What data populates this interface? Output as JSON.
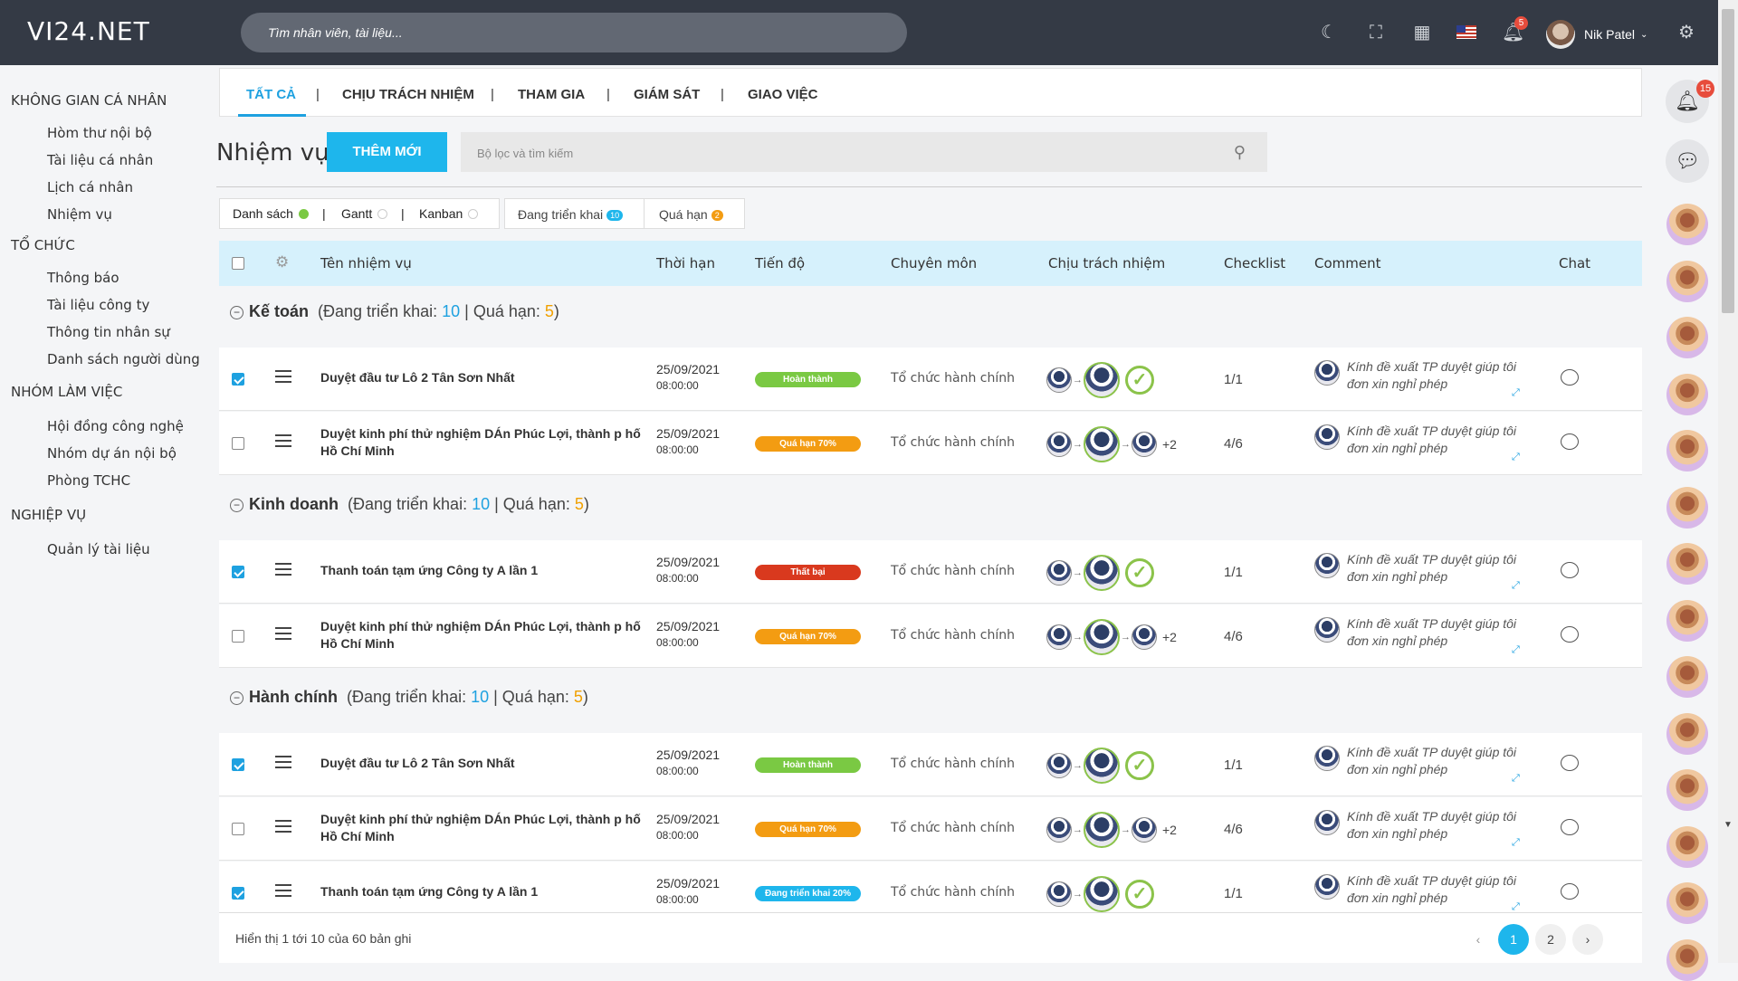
{
  "app": {
    "logo": "VI24.NET",
    "search_placeholder": "Tìm nhân viên, tài liệu...",
    "user_name": "Nik Patel",
    "notification_count": "5"
  },
  "sidebar": {
    "sections": [
      {
        "title": "KHÔNG GIAN CÁ NHÂN",
        "items": [
          "Hòm thư nội bộ",
          "Tài liệu cá nhân",
          "Lịch cá nhân",
          "Nhiệm vụ"
        ]
      },
      {
        "title": "TỔ CHỨC",
        "items": [
          "Thông báo",
          "Tài liệu công ty",
          "Thông tin nhân sự",
          "Danh sách người dùng"
        ]
      },
      {
        "title": "NHÓM LÀM VIỆC",
        "items": [
          "Hội đồng công nghệ",
          "Nhóm dự án nội bộ",
          "Phòng TCHC"
        ]
      },
      {
        "title": "NGHIỆP VỤ",
        "items": [
          "Quản lý tài liệu"
        ]
      }
    ]
  },
  "tabs": [
    "TẤT CẢ",
    "CHỊU TRÁCH NHIỆM",
    "THAM GIA",
    "GIÁM SÁT",
    "GIAO VIỆC"
  ],
  "page": {
    "title": "Nhiệm vụ",
    "add_button": "THÊM MỚI",
    "filter_placeholder": "Bộ lọc và tìm kiếm"
  },
  "views": {
    "list": "Danh sách",
    "gantt": "Gantt",
    "kanban": "Kanban"
  },
  "status_filters": {
    "active_label": "Đang triển khai",
    "active_count": "10",
    "overdue_label": "Quá hạn",
    "overdue_count": "2"
  },
  "table_headers": [
    "Tên nhiệm vụ",
    "Thời hạn",
    "Tiến độ",
    "Chuyên môn",
    "Chịu trách nhiệm",
    "Checklist",
    "Comment",
    "Chat"
  ],
  "groups": [
    {
      "name": "Kế toán",
      "active_label": "(Đang triển khai: ",
      "active": "10",
      "sep": " | Quá hạn: ",
      "overdue": "5",
      "close": ")"
    },
    {
      "name": "Kinh doanh",
      "active_label": "(Đang triển khai: ",
      "active": "10",
      "sep": " | Quá hạn: ",
      "overdue": "5",
      "close": ")"
    },
    {
      "name": "Hành chính",
      "active_label": "(Đang triển khai: ",
      "active": "10",
      "sep": " | Quá hạn: ",
      "overdue": "5",
      "close": ")"
    }
  ],
  "rows": [
    {
      "name": "Duyệt đầu tư Lô 2 Tân Sơn Nhất",
      "date": "25/09/2021",
      "time": "08:00:00",
      "progress": "Hoàn thành",
      "dept": "Tổ chức hành chính",
      "checklist": "1/1",
      "comment": "Kính đề xuất TP duyệt giúp tôi đơn xin nghỉ phép",
      "extra": ""
    },
    {
      "name": "Duyệt kinh phí thử nghiệm DÁn Phúc Lợi, thành p hố Hồ Chí Minh",
      "date": "25/09/2021",
      "time": "08:00:00",
      "progress": "Quá hạn 70%",
      "dept": "Tổ chức hành chính",
      "checklist": "4/6",
      "comment": "Kính đề xuất TP duyệt giúp tôi đơn xin nghỉ phép",
      "extra": "+2"
    },
    {
      "name": "Thanh toán tạm ứng Công ty A lần 1",
      "date": "25/09/2021",
      "time": "08:00:00",
      "progress": "Thất bại",
      "dept": "Tổ chức hành chính",
      "checklist": "1/1",
      "comment": "Kính đề xuất TP duyệt giúp tôi đơn xin nghỉ phép",
      "extra": ""
    },
    {
      "name": "Duyệt kinh phí thử nghiệm DÁn Phúc Lợi, thành p hố Hồ Chí Minh",
      "date": "25/09/2021",
      "time": "08:00:00",
      "progress": "Quá hạn 70%",
      "dept": "Tổ chức hành chính",
      "checklist": "4/6",
      "comment": "Kính đề xuất TP duyệt giúp tôi đơn xin nghỉ phép",
      "extra": "+2"
    },
    {
      "name": "Duyệt đầu tư Lô 2 Tân Sơn Nhất",
      "date": "25/09/2021",
      "time": "08:00:00",
      "progress": "Hoàn thành",
      "dept": "Tổ chức hành chính",
      "checklist": "1/1",
      "comment": "Kính đề xuất TP duyệt giúp tôi đơn xin nghỉ phép",
      "extra": ""
    },
    {
      "name": "Duyệt kinh phí thử nghiệm DÁn Phúc Lợi, thành p hố Hồ Chí Minh",
      "date": "25/09/2021",
      "time": "08:00:00",
      "progress": "Quá hạn 70%",
      "dept": "Tổ chức hành chính",
      "checklist": "4/6",
      "comment": "Kính đề xuất TP duyệt giúp tôi đơn xin nghỉ phép",
      "extra": "+2"
    },
    {
      "name": "Thanh toán tạm ứng Công ty A lần 1",
      "date": "25/09/2021",
      "time": "08:00:00",
      "progress": "Đang triển khai 20%",
      "dept": "Tổ chức hành chính",
      "checklist": "1/1",
      "comment": "Kính đề xuất TP duyệt giúp tôi đơn xin nghỉ phép",
      "extra": ""
    }
  ],
  "pagination": {
    "info": "Hiển thị 1 tới 10 của 60 bản ghi",
    "prev": "‹",
    "pages": [
      "1",
      "2"
    ],
    "next": "›"
  },
  "rightbar": {
    "notification_count": "15"
  },
  "colors": {
    "accent": "#1eb6ec",
    "green": "#7ac943",
    "orange": "#f39c12",
    "red": "#d9391e"
  }
}
